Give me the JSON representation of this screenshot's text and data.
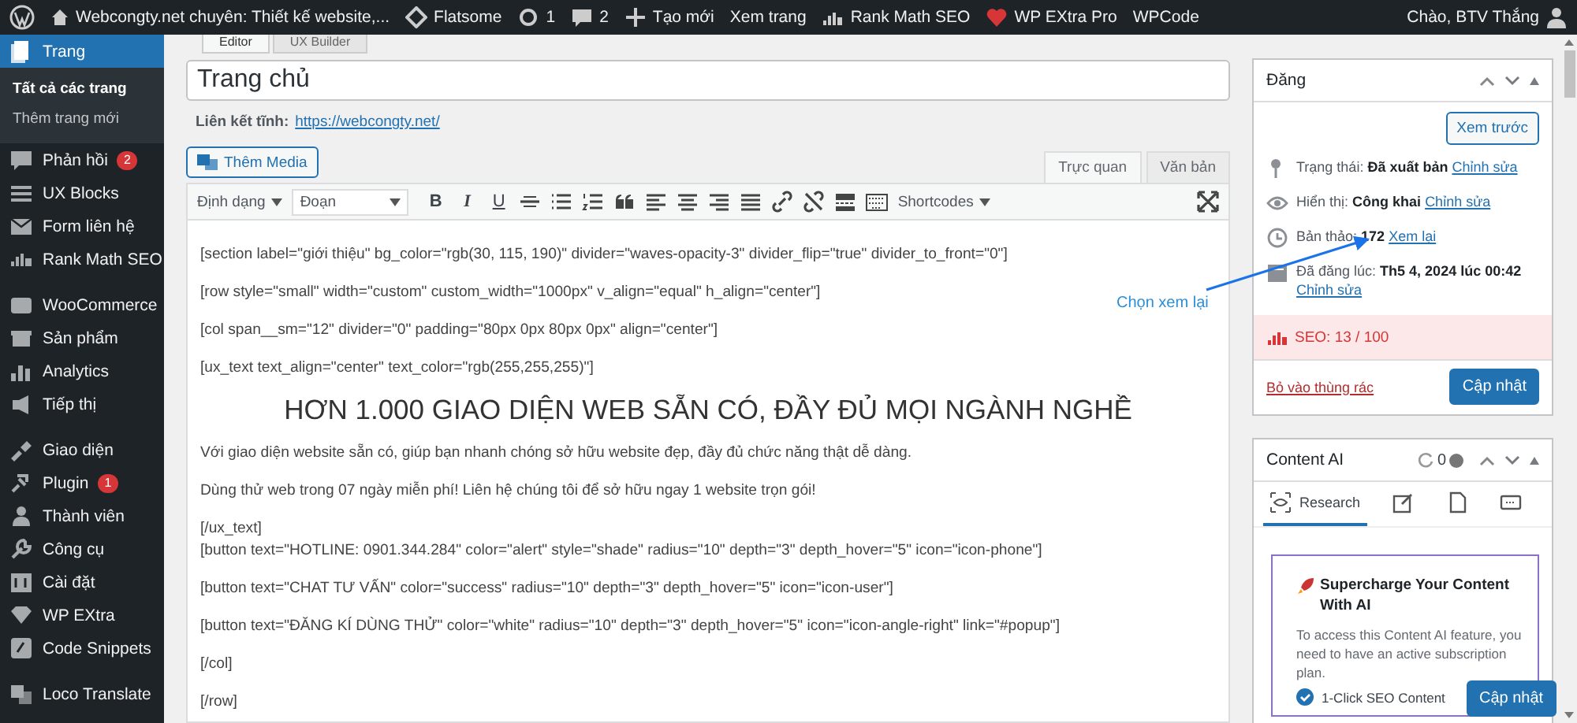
{
  "admin_bar": {
    "site_title": "Webcongty.net chuyên: Thiết kế website,...",
    "items": [
      {
        "label": "Flatsome"
      },
      {
        "label": "1"
      },
      {
        "label": "2"
      },
      {
        "label": "Tạo mới"
      },
      {
        "label": "Xem trang"
      },
      {
        "label": "Rank Math SEO"
      },
      {
        "label": "WP EXtra Pro"
      },
      {
        "label": "WPCode"
      }
    ],
    "greeting": "Chào, BTV Thắng"
  },
  "sidebar": {
    "groups": [
      [
        {
          "label": "Trang",
          "selected": true,
          "children": [
            {
              "label": "Tất cả các trang",
              "selected": true
            },
            {
              "label": "Thêm trang mới",
              "selected": false
            }
          ]
        },
        {
          "label": "Phản hồi",
          "selected": false,
          "badge": "2"
        },
        {
          "label": "UX Blocks",
          "selected": false
        },
        {
          "label": "Form liên hệ",
          "selected": false
        },
        {
          "label": "Rank Math SEO",
          "selected": false
        }
      ],
      [
        {
          "label": "WooCommerce",
          "selected": false
        },
        {
          "label": "Sản phẩm",
          "selected": false
        },
        {
          "label": "Analytics",
          "selected": false
        },
        {
          "label": "Tiếp thị",
          "selected": false
        }
      ],
      [
        {
          "label": "Giao diện",
          "selected": false
        },
        {
          "label": "Plugin",
          "selected": false,
          "badge": "1"
        },
        {
          "label": "Thành viên",
          "selected": false
        },
        {
          "label": "Công cụ",
          "selected": false
        },
        {
          "label": "Cài đặt",
          "selected": false
        },
        {
          "label": "WP EXtra",
          "selected": false
        },
        {
          "label": "Code Snippets",
          "selected": false
        }
      ],
      [
        {
          "label": "Loco Translate",
          "selected": false
        }
      ]
    ]
  },
  "editor": {
    "tabs": [
      {
        "label": "Editor",
        "selected": true
      },
      {
        "label": "UX Builder",
        "selected": false
      }
    ],
    "title": "Trang chủ",
    "permalink_label": "Liên kết tĩnh:",
    "permalink": "https://webcongty.net/",
    "media_button": "Thêm Media",
    "mode_tabs": [
      {
        "label": "Trực quan",
        "selected": true
      },
      {
        "label": "Văn bản",
        "selected": false
      }
    ],
    "format_menu": "Định dạng",
    "paragraph_select": "Đoạn",
    "text_buttons": [
      "B",
      "I",
      "U"
    ],
    "shortcodes_menu": "Shortcodes",
    "lines": [
      {
        "kind": "p",
        "text": "[section label=\"giới thiệu\" bg_color=\"rgb(30, 115, 190)\" divider=\"waves-opacity-3\" divider_flip=\"true\" divider_to_front=\"0\"]"
      },
      {
        "kind": "p",
        "text": "[row style=\"small\" width=\"custom\" custom_width=\"1000px\" v_align=\"equal\" h_align=\"center\"]"
      },
      {
        "kind": "p",
        "text": "[col span__sm=\"12\" divider=\"0\" padding=\"80px 0px 80px 0px\" align=\"center\"]"
      },
      {
        "kind": "p",
        "text": "[ux_text text_align=\"center\" text_color=\"rgb(255,255,255)\"]"
      },
      {
        "kind": "heading",
        "text": "HƠN 1.000 GIAO DIỆN WEB SẴN CÓ, ĐẦY ĐỦ MỌI NGÀNH NGHỀ"
      },
      {
        "kind": "p",
        "text": "Với giao diện website sẵn có, giúp bạn nhanh chóng sở hữu website đẹp, đầy đủ chức năng thật dễ dàng."
      },
      {
        "kind": "p",
        "text": "Dùng thử web trong 07 ngày miễn phí! Liên hệ chúng tôi để sở hữu ngay 1 website trọn gói!"
      },
      {
        "kind": "p",
        "text": "[/ux_text]"
      },
      {
        "kind": "cont",
        "text": "[button text=\"HOTLINE: 0901.344.284\" color=\"alert\" style=\"shade\" radius=\"10\" depth=\"3\" depth_hover=\"5\" icon=\"icon-phone\"]"
      },
      {
        "kind": "p",
        "text": "[button text=\"CHAT TƯ VẤN\" color=\"success\" radius=\"10\" depth=\"3\" depth_hover=\"5\" icon=\"icon-user\"]"
      },
      {
        "kind": "p",
        "text": "[button text=\"ĐĂNG KÍ DÙNG THỬ\" color=\"white\" radius=\"10\" depth=\"3\" depth_hover=\"5\" icon=\"icon-angle-right\" link=\"#popup\"]"
      },
      {
        "kind": "p",
        "text": "[/col]"
      },
      {
        "kind": "p",
        "text": "[/row]"
      }
    ]
  },
  "annotation": {
    "label": "Chọn xem lại"
  },
  "publish_box": {
    "title": "Đăng",
    "preview_button": "Xem trước",
    "rows": [
      {
        "label": "Trạng thái:",
        "value": "Đã xuất bản",
        "link": "Chỉnh sửa"
      },
      {
        "label": "Hiển thị:",
        "value": "Công khai",
        "link": "Chỉnh sửa"
      },
      {
        "label": "Bản thảo:",
        "value": "172",
        "link": "Xem lại"
      },
      {
        "label": "Đã đăng lúc:",
        "value": "Th5 4, 2024 lúc 00:42",
        "link": "Chỉnh sửa"
      }
    ],
    "seo_score": "SEO: 13 / 100",
    "trash_link": "Bỏ vào thùng rác",
    "update_button": "Cập nhật"
  },
  "content_ai": {
    "title": "Content AI",
    "credits": "0",
    "tabs": [
      {
        "label": "Research",
        "selected": true
      },
      {
        "selected": false
      },
      {
        "selected": false
      },
      {
        "selected": false
      }
    ],
    "popup": {
      "title": "Supercharge Your Content With AI",
      "text": "To access this Content AI feature, you need to have an active subscription plan.",
      "features": [
        {
          "label": "1-Click SEO Content",
          "checked": true
        }
      ]
    }
  },
  "floating_update_button": "Cập nhật"
}
